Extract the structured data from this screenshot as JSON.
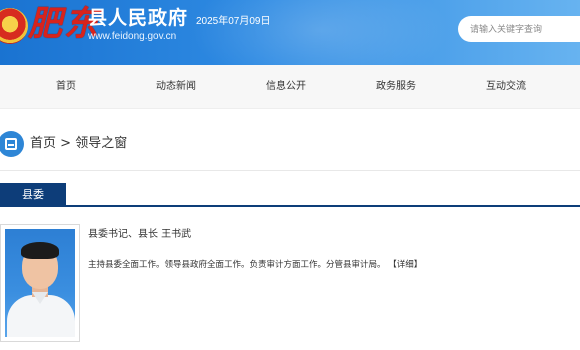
{
  "header": {
    "calligraphy": "肥东",
    "title": "县人民政府",
    "url": "www.feidong.gov.cn",
    "date": "2025年07月09日",
    "search_placeholder": "请输入关键字查询",
    "emblem_icon": "national-emblem-icon",
    "colors": {
      "header_start": "#1a73d1",
      "header_end": "#67b3f0",
      "calligraphy": "#d8231c"
    }
  },
  "nav": {
    "items": [
      {
        "label": "首页"
      },
      {
        "label": "动态新闻"
      },
      {
        "label": "信息公开"
      },
      {
        "label": "政务服务"
      },
      {
        "label": "互动交流"
      }
    ]
  },
  "breadcrumb": {
    "icon": "page-icon",
    "home": "首页",
    "separator": " > ",
    "current": "领导之窗"
  },
  "section": {
    "tab_label": "县委",
    "accent": "#0d3d79"
  },
  "leader": {
    "title": "县委书记、县长 王书武",
    "description": "主持县委全面工作。领导县政府全面工作。负责审计方面工作。分管县审计局。",
    "detail_link": "【详细】"
  }
}
